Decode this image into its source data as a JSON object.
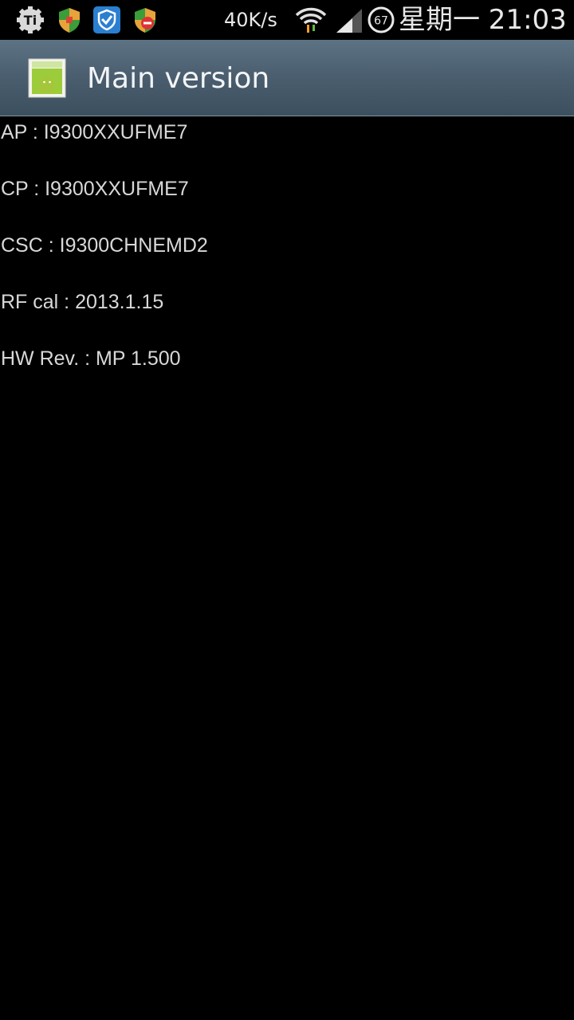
{
  "status_bar": {
    "icons_left": [
      "titanium-backup-icon",
      "security-shield-icon",
      "check-shield-icon",
      "blocked-shield-icon"
    ],
    "network_speed": "40K/s",
    "battery_level": "67",
    "clock": "星期一 21:03",
    "icons_right": [
      "wifi-icon",
      "signal-icon",
      "battery-icon"
    ]
  },
  "action_bar": {
    "app_icon": "android-app-icon",
    "title": "Main version"
  },
  "info": {
    "items": [
      {
        "text": "AP : I9300XXUFME7"
      },
      {
        "text": "CP : I9300XXUFME7"
      },
      {
        "text": "CSC : I9300CHNEMD2"
      },
      {
        "text": "RF cal : 2013.1.15"
      },
      {
        "text": "HW Rev. : MP 1.500"
      }
    ]
  },
  "colors": {
    "background": "#000000",
    "action_bar": "#4b5f70",
    "text": "#d8d8d8"
  }
}
